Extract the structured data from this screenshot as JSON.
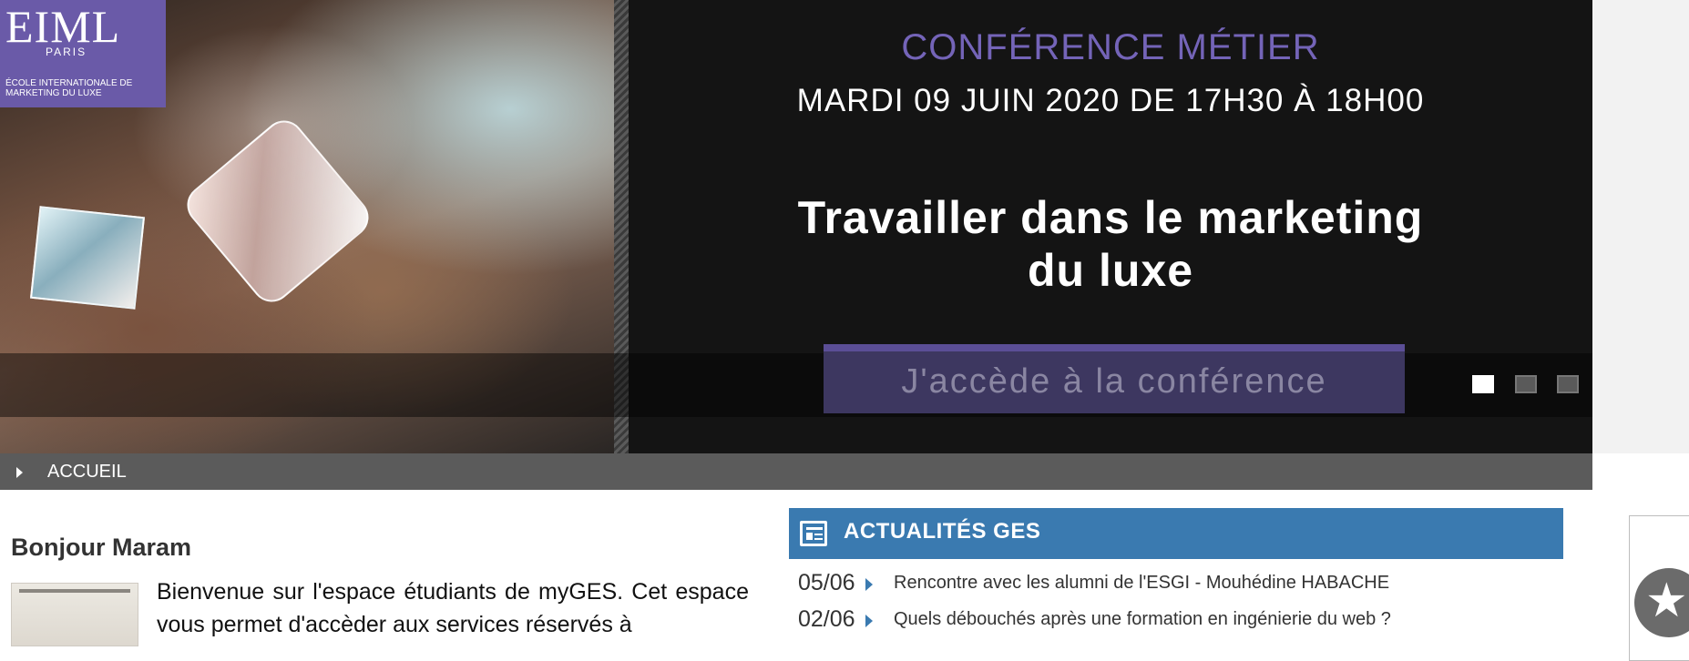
{
  "banner": {
    "logo": {
      "name": "EIML",
      "city": "PARIS",
      "subtitle": "ÉCOLE INTERNATIONALE DE MARKETING DU LUXE"
    },
    "title": "CONFÉRENCE MÉTIER",
    "date": "MARDI 09 JUIN 2020 DE 17H30 À 18H00",
    "headline_line1": "Travailler dans le marketing",
    "headline_line2": "du luxe",
    "cta": "J'accède à la conférence",
    "slides_total": 3,
    "slide_active": 1
  },
  "breadcrumb": {
    "label": "ACCUEIL"
  },
  "welcome": {
    "greeting": "Bonjour Maram",
    "text": "Bienvenue sur l'espace étudiants de myGES. Cet espace vous permet d'accèder aux services réservés à"
  },
  "news": {
    "title": "ACTUALITÉS GES",
    "items": [
      {
        "date": "05/06",
        "title": "Rencontre avec les alumni de l'ESGI - Mouhédine HABACHE"
      },
      {
        "date": "02/06",
        "title": "Quels débouchés après une formation en ingénierie du web ?"
      }
    ]
  },
  "colors": {
    "accent_blue": "#3a7ab0",
    "accent_purple": "#6a5aa8",
    "breadcrumb_bg": "#5b5b5b"
  },
  "icons": {
    "news": "newspaper-icon",
    "favorite": "star-icon",
    "breadcrumb": "caret-right-icon",
    "news_bullet": "caret-right-icon"
  }
}
